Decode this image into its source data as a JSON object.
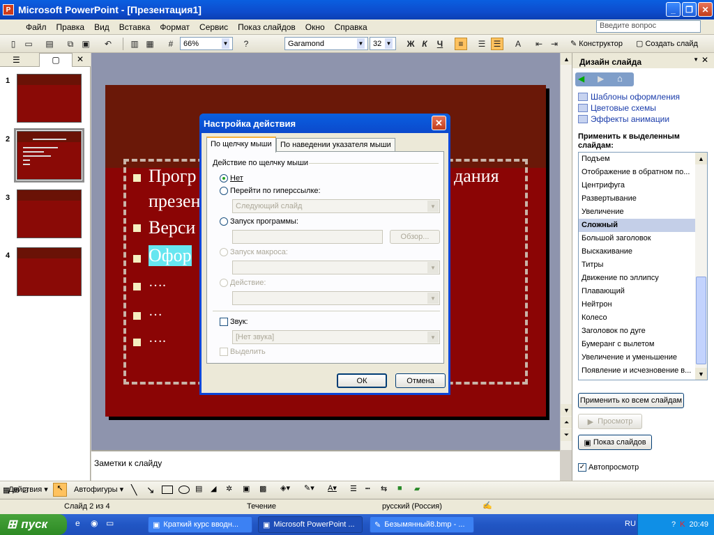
{
  "window": {
    "title": "Microsoft PowerPoint - [Презентация1]",
    "app_icon": "powerpoint-icon"
  },
  "menu": {
    "items": [
      "Файл",
      "Правка",
      "Вид",
      "Вставка",
      "Формат",
      "Сервис",
      "Показ слайдов",
      "Окно",
      "Справка"
    ],
    "ask_placeholder": "Введите вопрос"
  },
  "toolbar": {
    "zoom": "66%",
    "font": "Garamond",
    "size": "32",
    "bold": "Ж",
    "italic": "К",
    "underline": "Ч",
    "designer": "Конструктор",
    "new_slide": "Создать слайд"
  },
  "thumbnails": {
    "numbers": [
      "1",
      "2",
      "3",
      "4"
    ],
    "selected": "2"
  },
  "slide": {
    "bullets": [
      "Прогр",
      "презен",
      "Верси",
      "Офор",
      "….",
      "…",
      "…."
    ],
    "bullet_line1_right": "дания"
  },
  "notes": {
    "placeholder": "Заметки к слайду"
  },
  "taskpane": {
    "title": "Дизайн слайда",
    "links": [
      "Шаблоны оформления",
      "Цветовые схемы",
      "Эффекты анимации"
    ],
    "apply_label": "Применить к выделенным слайдам:",
    "animations": [
      "Подъем",
      "Отображение в обратном по...",
      "Центрифуга",
      "Развертывание",
      "Увеличение",
      "Сложный",
      "Большой заголовок",
      "Выскакивание",
      "Титры",
      "Движение по эллипсу",
      "Плавающий",
      "Нейтрон",
      "Колесо",
      "Заголовок по дуге",
      "Бумеранг с вылетом",
      "Увеличение и уменьшение",
      "Появление и исчезновение в..."
    ],
    "selected_animation": "Сложный",
    "apply_all": "Применить ко всем слайдам",
    "preview": "Просмотр",
    "slideshow": "Показ слайдов",
    "autopreview": "Автопросмотр"
  },
  "drawing": {
    "actions": "Действия",
    "autoshapes": "Автофигуры"
  },
  "status": {
    "slide": "Слайд 2 из 4",
    "design": "Течение",
    "language": "русский (Россия)"
  },
  "taskbar": {
    "start": "пуск",
    "items": [
      "Краткий курс вводн...",
      "Microsoft PowerPoint ...",
      "Безымянный8.bmp - ..."
    ],
    "lang": "RU",
    "time": "20:49"
  },
  "dialog": {
    "title": "Настройка действия",
    "tab1": "По щелчку мыши",
    "tab2": "По наведении указателя мыши",
    "group": "Действие по щелчку мыши",
    "opt_none": "Нет",
    "opt_hyperlink": "Перейти по гиперссылке:",
    "hyperlink_value": "Следующий слайд",
    "opt_program": "Запуск программы:",
    "browse": "Обзор...",
    "opt_macro": "Запуск макроса:",
    "opt_action": "Действие:",
    "sound": "Звук:",
    "sound_value": "[Нет звука]",
    "highlight": "Выделить",
    "ok": "ОК",
    "cancel": "Отмена"
  }
}
